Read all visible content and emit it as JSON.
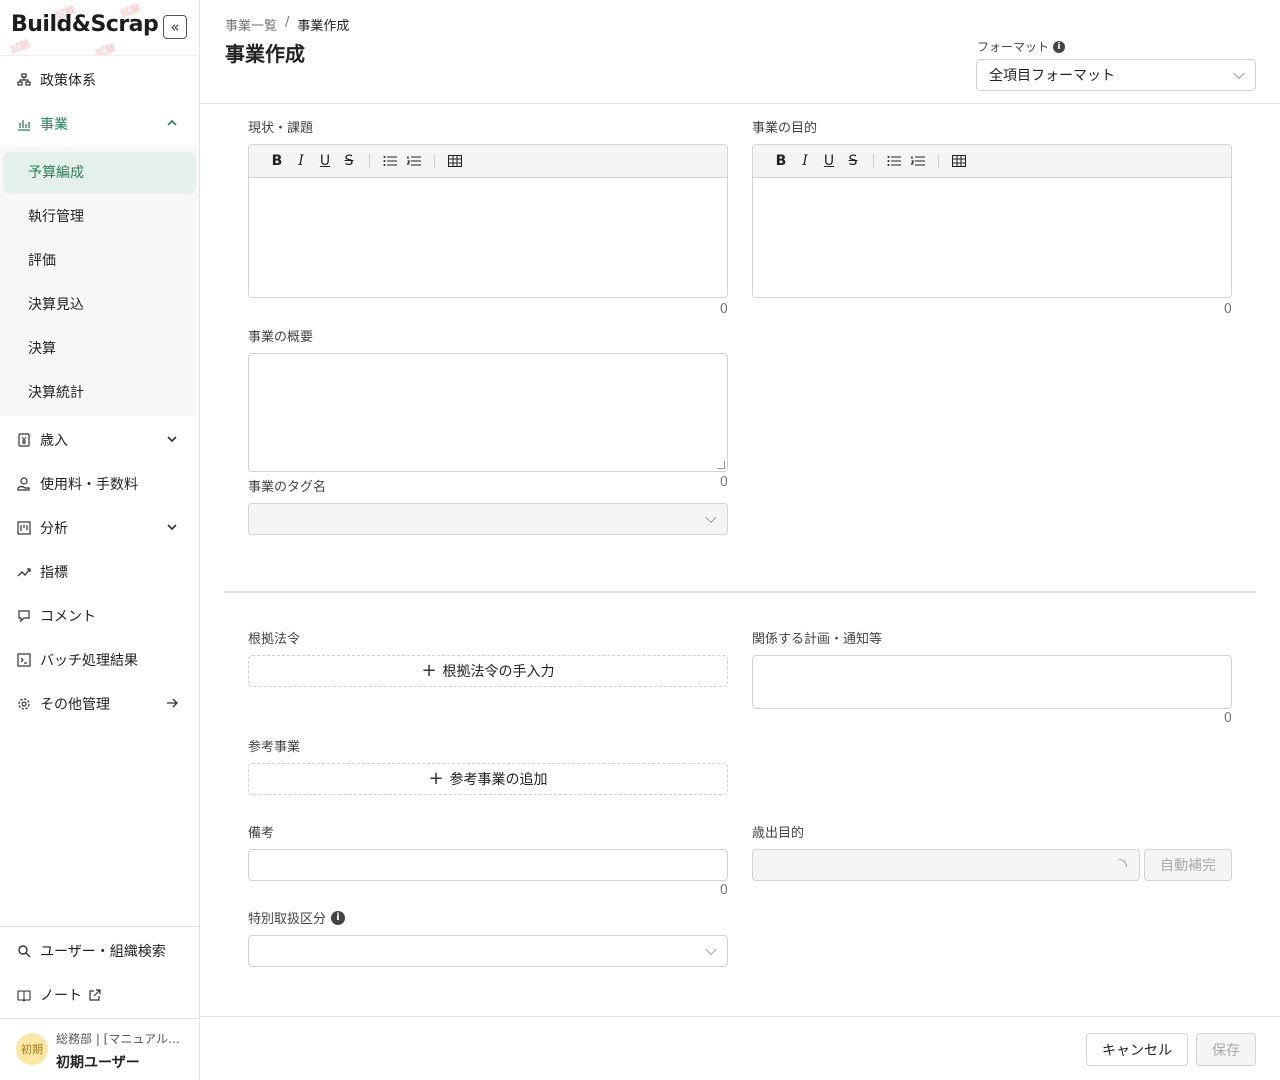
{
  "logo": {
    "text": "Build&Scrap",
    "stamp": "試験"
  },
  "sidebar": {
    "collapse_icon": "«",
    "items": [
      {
        "label": "政策体系",
        "icon": "org-chart-icon"
      },
      {
        "label": "事業",
        "icon": "bar-chart-icon"
      },
      {
        "label": "歳入",
        "icon": "revenue-icon"
      },
      {
        "label": "使用料・手数料",
        "icon": "fee-icon"
      },
      {
        "label": "分析",
        "icon": "analysis-icon"
      },
      {
        "label": "指標",
        "icon": "trend-icon"
      },
      {
        "label": "コメント",
        "icon": "comment-icon"
      },
      {
        "label": "バッチ処理結果",
        "icon": "terminal-icon"
      },
      {
        "label": "その他管理",
        "icon": "gear-icon"
      }
    ],
    "sub_items": [
      "予算編成",
      "執行管理",
      "評価",
      "決算見込",
      "決算",
      "決算統計"
    ],
    "bottom": [
      {
        "label": "ユーザー・組織検索",
        "icon": "search-icon"
      },
      {
        "label": "ノート",
        "icon": "book-icon"
      }
    ],
    "user": {
      "avatar": "初期",
      "dept": "総務部 | [マニュアル…",
      "name": "初期ユーザー"
    }
  },
  "header": {
    "breadcrumb": [
      "事業一覧",
      "/",
      "事業作成"
    ],
    "title": "事業作成",
    "format_label": "フォーマット",
    "format_value": "全項目フォーマット"
  },
  "form": {
    "current_issues": {
      "label": "現状・課題",
      "count": "0"
    },
    "purpose": {
      "label": "事業の目的",
      "count": "0"
    },
    "overview": {
      "label": "事業の概要",
      "count": "0"
    },
    "tags": {
      "label": "事業のタグ名"
    },
    "legal_basis": {
      "label": "根拠法令",
      "button": "根拠法令の手入力"
    },
    "related_plans": {
      "label": "関係する計画・通知等",
      "count": "0"
    },
    "reference": {
      "label": "参考事業",
      "button": "参考事業の追加"
    },
    "remarks": {
      "label": "備考",
      "count": "0"
    },
    "expense_purpose": {
      "label": "歳出目的",
      "auto_button": "自動補完"
    },
    "special": {
      "label": "特別取扱区分"
    }
  },
  "toolbar": {
    "bold": "B",
    "italic": "I",
    "underline": "U",
    "strike": "S"
  },
  "footer": {
    "cancel": "キャンセル",
    "save": "保存"
  },
  "colors": {
    "accent": "#2e7d5b",
    "active_bg": "#e3f1ea"
  }
}
